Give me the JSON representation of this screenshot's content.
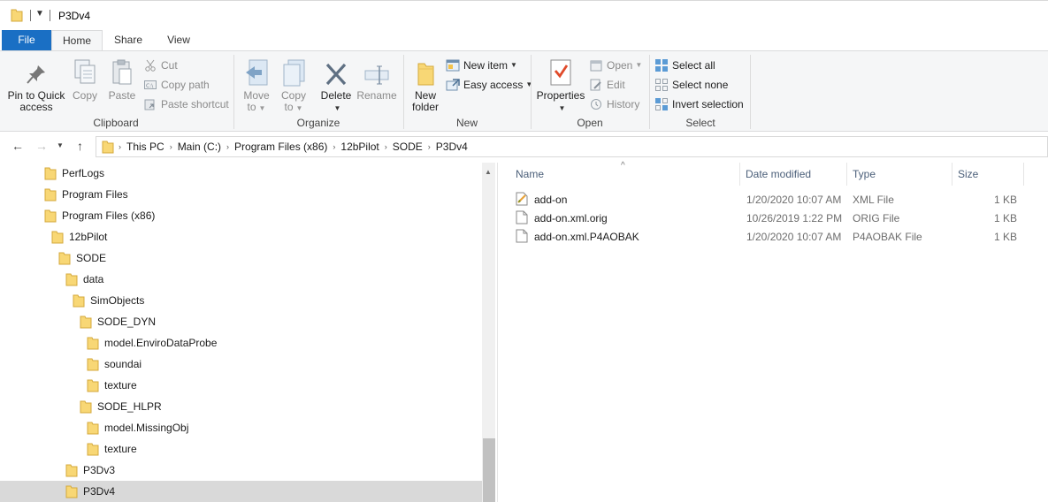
{
  "window": {
    "title": "P3Dv4"
  },
  "tabs": {
    "file": "File",
    "home": "Home",
    "share": "Share",
    "view": "View"
  },
  "ribbon": {
    "clipboard": {
      "label": "Clipboard",
      "pin_line1": "Pin to Quick",
      "pin_line2": "access",
      "copy": "Copy",
      "paste": "Paste",
      "cut": "Cut",
      "copy_path": "Copy path",
      "paste_shortcut": "Paste shortcut"
    },
    "organize": {
      "label": "Organize",
      "move_line1": "Move",
      "move_line2": "to",
      "copy_line1": "Copy",
      "copy_line2": "to",
      "delete": "Delete",
      "rename": "Rename"
    },
    "new": {
      "label": "New",
      "folder_line1": "New",
      "folder_line2": "folder",
      "new_item": "New item",
      "easy_access": "Easy access"
    },
    "open": {
      "label": "Open",
      "properties": "Properties",
      "open": "Open",
      "edit": "Edit",
      "history": "History"
    },
    "select": {
      "label": "Select",
      "select_all": "Select all",
      "select_none": "Select none",
      "invert": "Invert selection"
    }
  },
  "address": {
    "crumbs": [
      "This PC",
      "Main (C:)",
      "Program Files (x86)",
      "12bPilot",
      "SODE",
      "P3Dv4"
    ]
  },
  "tree": [
    {
      "label": "PerfLogs"
    },
    {
      "label": "Program Files"
    },
    {
      "label": "Program Files (x86)"
    },
    {
      "label": "12bPilot"
    },
    {
      "label": "SODE"
    },
    {
      "label": "data"
    },
    {
      "label": "SimObjects"
    },
    {
      "label": "SODE_DYN"
    },
    {
      "label": "model.EnviroDataProbe"
    },
    {
      "label": "soundai"
    },
    {
      "label": "texture"
    },
    {
      "label": "SODE_HLPR"
    },
    {
      "label": "model.MissingObj"
    },
    {
      "label": "texture"
    },
    {
      "label": "P3Dv3"
    },
    {
      "label": "P3Dv4",
      "selected": true
    }
  ],
  "columns": {
    "name": "Name",
    "date": "Date modified",
    "type": "Type",
    "size": "Size"
  },
  "files": [
    {
      "name": "add-on",
      "date": "1/20/2020 10:07 AM",
      "type": "XML File",
      "size": "1 KB",
      "icon": "xml-file-icon"
    },
    {
      "name": "add-on.xml.orig",
      "date": "10/26/2019 1:22 PM",
      "type": "ORIG File",
      "size": "1 KB",
      "icon": "generic-file-icon"
    },
    {
      "name": "add-on.xml.P4AOBAK",
      "date": "1/20/2020 10:07 AM",
      "type": "P4AOBAK File",
      "size": "1 KB",
      "icon": "generic-file-icon"
    }
  ],
  "colors": {
    "accent": "#1a6fc4",
    "folder": "#f8d775",
    "folder_dark": "#e0b850",
    "selection": "#d9d9d9"
  }
}
